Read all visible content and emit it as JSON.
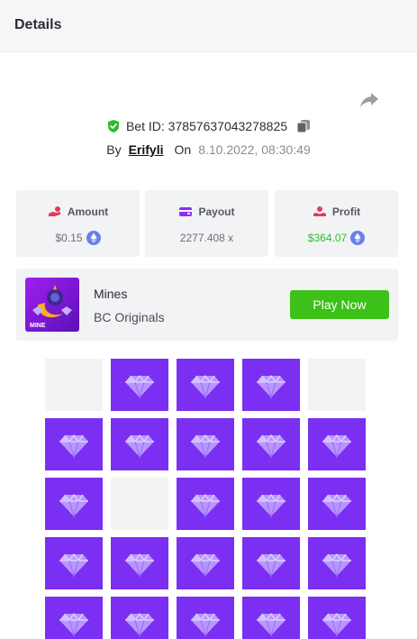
{
  "header": {
    "title": "Details"
  },
  "bet": {
    "id_label": "Bet ID: 37857637043278825",
    "by_label": "By",
    "username": "Erifyli",
    "on_label": "On",
    "datetime": "8.10.2022, 08:30:49"
  },
  "stats": {
    "amount": {
      "label": "Amount",
      "value": "$0.15",
      "icon": "hand-coins-icon",
      "currency_icon": "eth-icon"
    },
    "payout": {
      "label": "Payout",
      "value": "2277.408 x",
      "icon": "wallet-icon"
    },
    "profit": {
      "label": "Profit",
      "value": "$364.07",
      "icon": "hand-money-icon",
      "currency_icon": "eth-icon"
    }
  },
  "game": {
    "name": "Mines",
    "provider": "BC Originals",
    "thumb_label": "MINE",
    "play_label": "Play Now"
  },
  "board": {
    "columns": 5,
    "rows_visible": 5,
    "tiles": [
      "empty",
      "gem",
      "gem",
      "gem",
      "empty",
      "gem",
      "gem",
      "gem",
      "gem",
      "gem",
      "gem",
      "empty",
      "gem",
      "gem",
      "gem",
      "gem",
      "gem",
      "gem",
      "gem",
      "gem",
      "gem",
      "gem",
      "gem",
      "gem",
      "gem"
    ]
  },
  "colors": {
    "accent_green": "#3bc117",
    "profit_green": "#2fbc2b",
    "gem_tile": "#7b2ff2",
    "empty_tile": "#f2f3f5"
  }
}
